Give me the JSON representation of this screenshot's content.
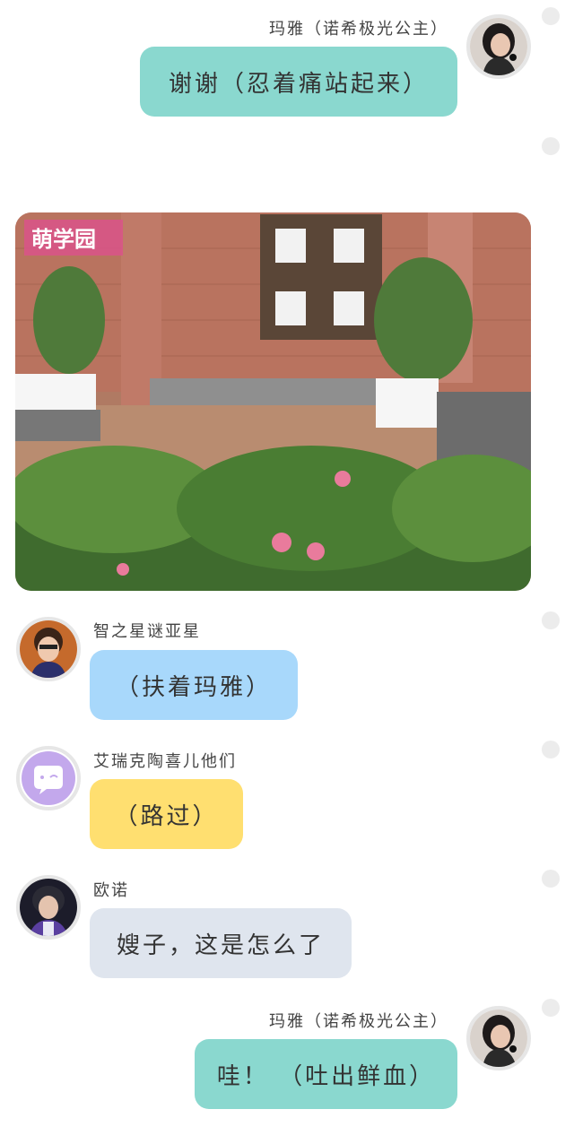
{
  "colors": {
    "teal_bubble": "#8ad8cf",
    "blue_bubble": "#a8d8fb",
    "yellow_bubble": "#ffdf70",
    "gray_bubble": "#dfe5ee",
    "placeholder_avatar": "#c3a8ec"
  },
  "messages": [
    {
      "sender": "玛雅（诺希极光公主）",
      "text": "谢谢（忍着痛站起来）",
      "side": "right"
    },
    {
      "sender": "",
      "text": "",
      "side": "center",
      "kind": "image"
    },
    {
      "sender": "智之星谜亚星",
      "text": "（扶着玛雅）",
      "side": "left"
    },
    {
      "sender": "艾瑞克陶喜儿他们",
      "text": "（路过）",
      "side": "left",
      "avatar_icon": "chat-bubble-icon"
    },
    {
      "sender": "欧诺",
      "text": "嫂子，这是怎么了",
      "side": "left"
    },
    {
      "sender": "玛雅（诺希极光公主）",
      "text": "哇！ （吐出鲜血）",
      "side": "right"
    }
  ],
  "scene_logo": "萌学园"
}
